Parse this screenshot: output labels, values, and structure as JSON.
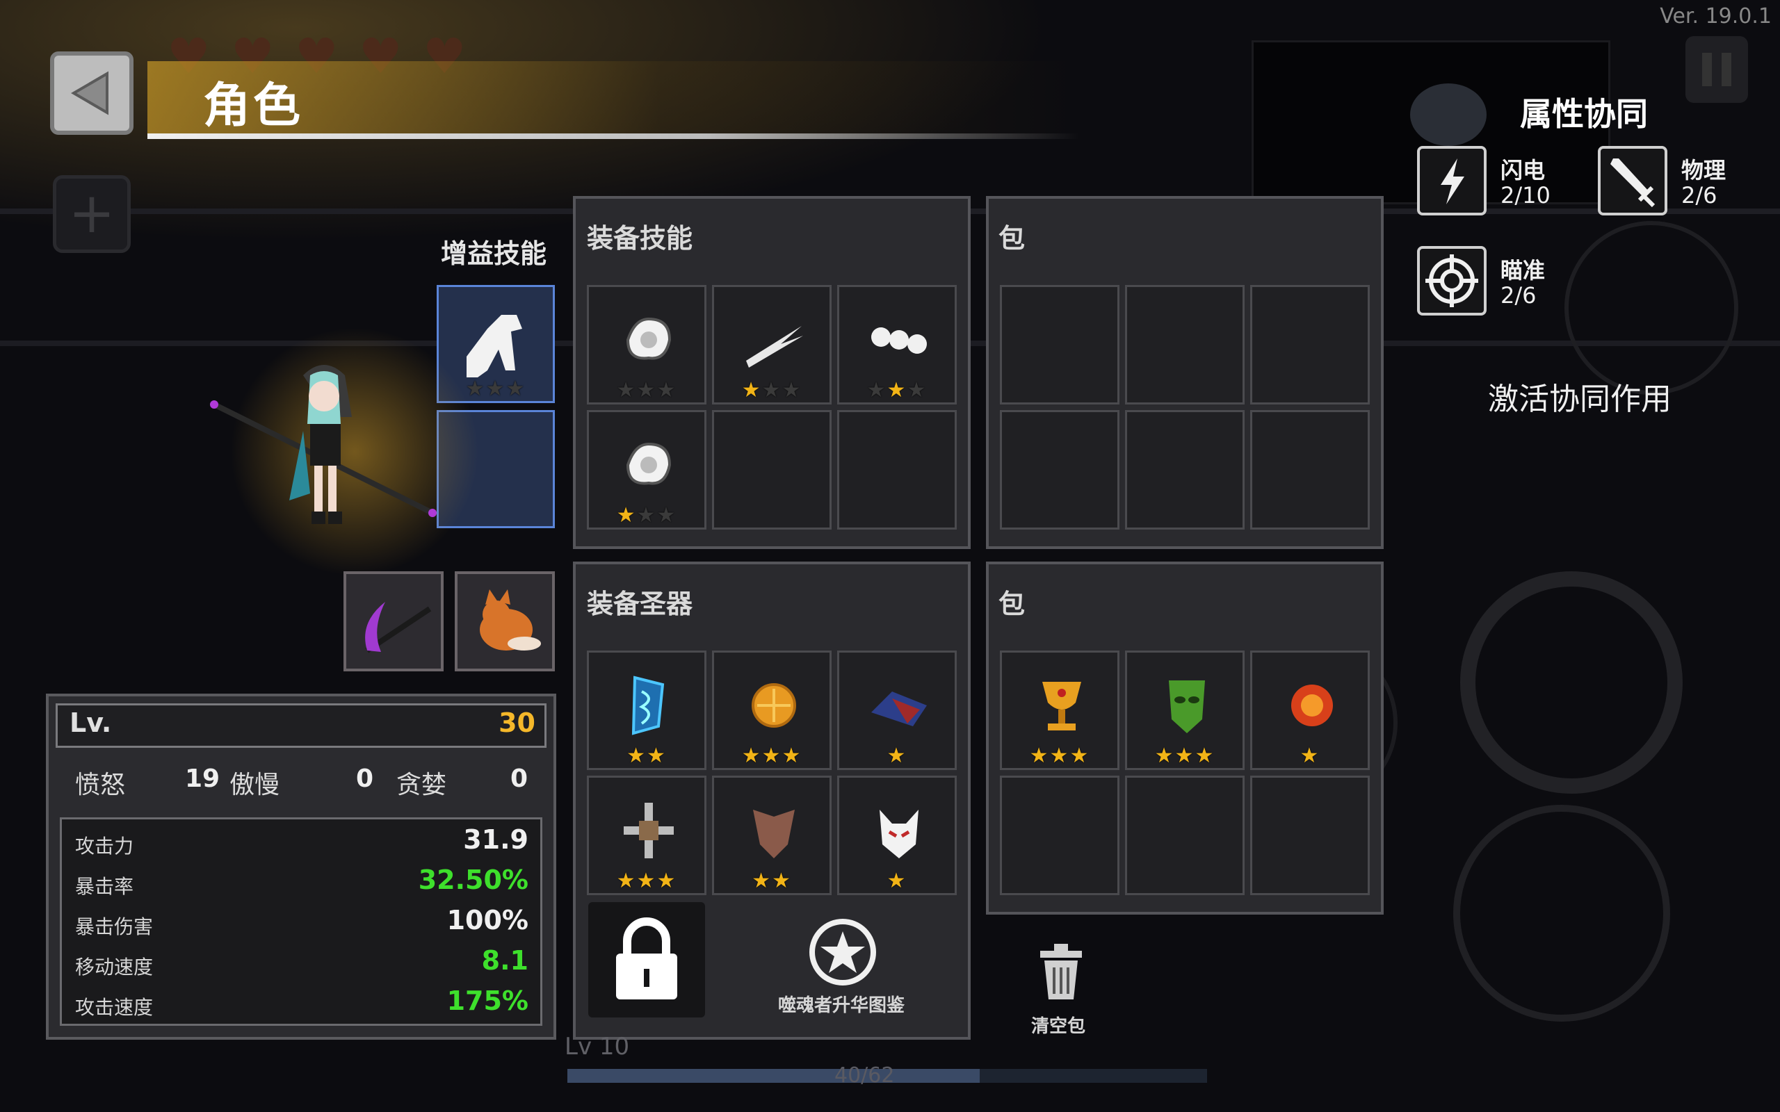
{
  "version": "Ver. 19.0.1",
  "page_title": "角色",
  "buff_skill": {
    "label": "增益技能",
    "slots": [
      {
        "icon": "tower-icon",
        "stars": 0
      },
      {
        "icon": "empty",
        "stars": 0
      }
    ]
  },
  "stats": {
    "lv_label": "Lv.",
    "level": "30",
    "sins": [
      {
        "label": "愤怒",
        "value": "19"
      },
      {
        "label": "傲慢",
        "value": "0"
      },
      {
        "label": "贪婪",
        "value": "0"
      }
    ],
    "rows": [
      {
        "label": "攻击力",
        "value": "31.9",
        "color": "#f0f0f0"
      },
      {
        "label": "暴击率",
        "value": "32.50%",
        "color": "#3ee02c"
      },
      {
        "label": "暴击伤害",
        "value": "100%",
        "color": "#f0f0f0"
      },
      {
        "label": "移动速度",
        "value": "8.1",
        "color": "#3ee02c"
      },
      {
        "label": "攻击速度",
        "value": "175%",
        "color": "#3ee02c"
      }
    ]
  },
  "equip_skills": {
    "title": "装备技能",
    "slots": [
      {
        "icon": "spirit-burst-icon",
        "stars": 0
      },
      {
        "icon": "lightning-slash-icon",
        "stars": 1
      },
      {
        "icon": "chain-orbs-icon",
        "stars": 2
      },
      {
        "icon": "spirit-burst-icon",
        "stars": 1
      },
      {
        "icon": "empty",
        "stars": 0
      },
      {
        "icon": "empty",
        "stars": 0
      }
    ]
  },
  "skill_bag": {
    "title": "包"
  },
  "equip_relics": {
    "title": "装备圣器",
    "slots": [
      {
        "icon": "blue-flag-icon",
        "stars": 2,
        "max": 2
      },
      {
        "icon": "gold-coin-icon",
        "stars": 3,
        "max": 3
      },
      {
        "icon": "dragon-wing-icon",
        "stars": 1,
        "max": 1
      },
      {
        "icon": "iron-cross-icon",
        "stars": 3,
        "max": 3
      },
      {
        "icon": "leather-armor-icon",
        "stars": 2,
        "max": 2
      },
      {
        "icon": "fox-mask-icon",
        "stars": 1,
        "max": 1
      }
    ]
  },
  "relic_bag": {
    "title": "包",
    "slots": [
      {
        "icon": "gold-chalice-icon",
        "stars": 3,
        "max": 3
      },
      {
        "icon": "green-mask-icon",
        "stars": 3,
        "max": 3
      },
      {
        "icon": "fire-orb-icon",
        "stars": 1,
        "max": 1
      }
    ]
  },
  "codex_label": "噬魂者升华图鉴",
  "clear_bag_label": "清空包",
  "bottom": {
    "level_text": "Lv 10",
    "xp_text": "40/62",
    "xp_fraction": 0.645
  },
  "synergy": {
    "title": "属性协同",
    "items": [
      {
        "name": "闪电",
        "count": "2/10",
        "icon": "lightning-icon"
      },
      {
        "name": "物理",
        "count": "2/6",
        "icon": "sword-icon"
      },
      {
        "name": "瞄准",
        "count": "2/6",
        "icon": "crosshair-icon"
      }
    ],
    "activate_label": "激活协同作用"
  },
  "colors": {
    "star": "#f2b417",
    "accent_gold": "#f5b82a",
    "buff_bonus": "#3ee02c"
  }
}
